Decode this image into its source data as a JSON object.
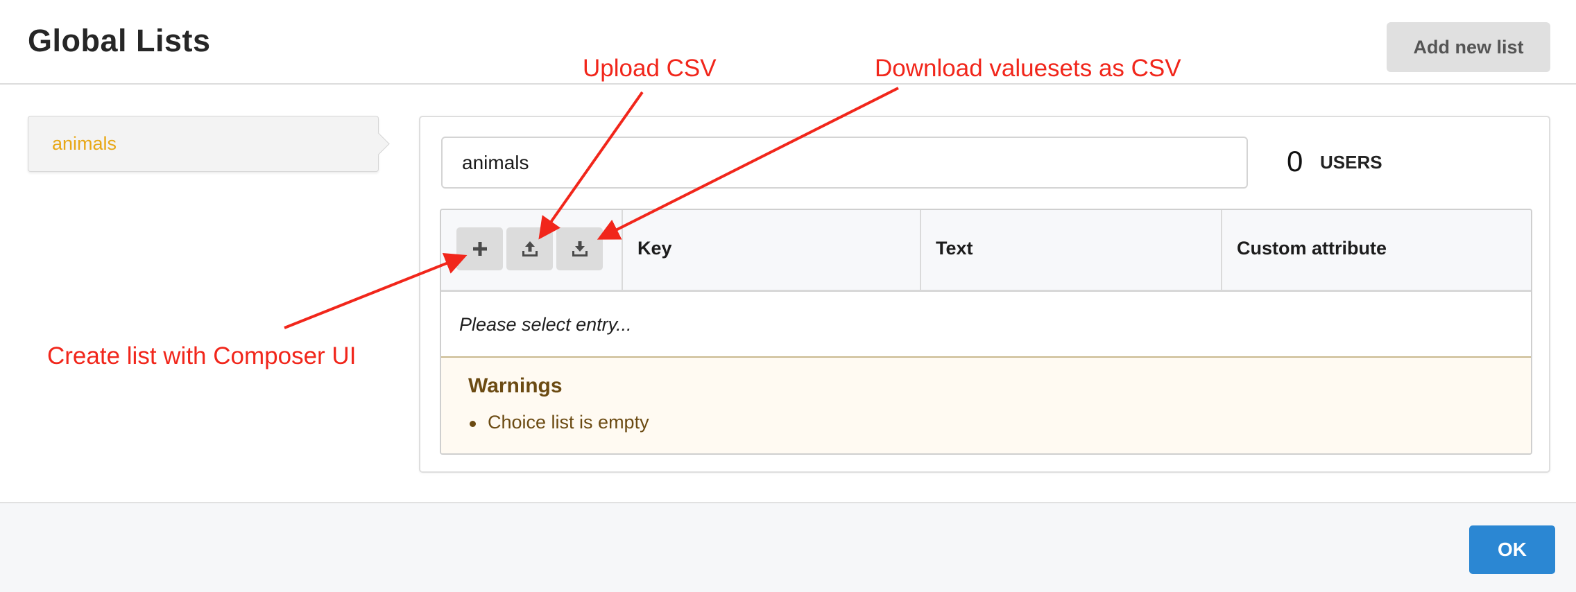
{
  "header": {
    "title": "Global Lists",
    "add_button_label": "Add new list"
  },
  "sidebar": {
    "items": [
      {
        "label": "animals",
        "selected": true
      }
    ]
  },
  "editor": {
    "list_name_value": "animals",
    "users_count": "0",
    "users_label": "USERS",
    "toolbar_icons": [
      "plus-icon",
      "upload-icon",
      "download-icon"
    ],
    "columns": [
      "Key",
      "Text",
      "Custom attribute"
    ],
    "empty_message": "Please select entry...",
    "warnings": {
      "title": "Warnings",
      "items": [
        "Choice list is empty"
      ]
    }
  },
  "footer": {
    "ok_label": "OK"
  },
  "annotations": {
    "upload": "Upload CSV",
    "download": "Download valuesets as CSV",
    "create": "Create list with Composer UI"
  },
  "colors": {
    "accent": "#2b87d3",
    "selected_item": "#e8a817",
    "annotation": "#f1261b",
    "warning_text": "#6b4a12",
    "warning_bg": "#fffaf2"
  }
}
